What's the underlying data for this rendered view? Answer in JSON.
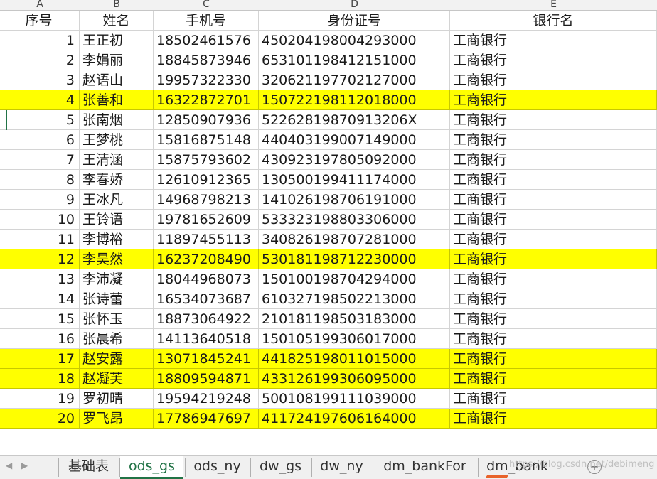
{
  "columns": [
    "A",
    "B",
    "C",
    "D",
    "E"
  ],
  "headers": [
    "序号",
    "姓名",
    "手机号",
    "身份证号",
    "银行名"
  ],
  "rows": [
    [
      "1",
      "王正初",
      "18502461576",
      "450204198004293000",
      "工商银行"
    ],
    [
      "2",
      "李娟丽",
      "18845873946",
      "653101198412151000",
      "工商银行"
    ],
    [
      "3",
      "赵语山",
      "19957322330",
      "320621197702127000",
      "工商银行"
    ],
    [
      "4",
      "张善和",
      "16322872701",
      "150722198112018000",
      "工商银行"
    ],
    [
      "5",
      "张南烟",
      "12850907936",
      "52262819870913206X",
      "工商银行"
    ],
    [
      "6",
      "王梦桃",
      "15816875148",
      "440403199007149000",
      "工商银行"
    ],
    [
      "7",
      "王清涵",
      "15875793602",
      "430923197805092000",
      "工商银行"
    ],
    [
      "8",
      "李春娇",
      "12610912365",
      "130500199411174000",
      "工商银行"
    ],
    [
      "9",
      "王冰凡",
      "14968798213",
      "141026198706191000",
      "工商银行"
    ],
    [
      "10",
      "王铃语",
      "19781652609",
      "533323198803306000",
      "工商银行"
    ],
    [
      "11",
      "李博裕",
      "11897455113",
      "340826198707281000",
      "工商银行"
    ],
    [
      "12",
      "李昊然",
      "16237208490",
      "530181198712230000",
      "工商银行"
    ],
    [
      "13",
      "李沛凝",
      "18044968073",
      "150100198704294000",
      "工商银行"
    ],
    [
      "14",
      "张诗蕾",
      "16534073687",
      "610327198502213000",
      "工商银行"
    ],
    [
      "15",
      "张怀玉",
      "18873064922",
      "210181198503183000",
      "工商银行"
    ],
    [
      "16",
      "张晨希",
      "14113640518",
      "150105199306017000",
      "工商银行"
    ],
    [
      "17",
      "赵安露",
      "13071845241",
      "441825198011015000",
      "工商银行"
    ],
    [
      "18",
      "赵凝芙",
      "18809594871",
      "433126199306095000",
      "工商银行"
    ],
    [
      "19",
      "罗初晴",
      "19594219248",
      "500108199111039000",
      "工商银行"
    ],
    [
      "20",
      "罗飞昂",
      "17786947697",
      "411724197606164000",
      "工商银行"
    ]
  ],
  "highlighted_rows": [
    "4",
    "12",
    "17",
    "18",
    "20"
  ],
  "highlight_color": "#ffff00",
  "sheet_tabs": [
    "基础表",
    "ods_gs",
    "ods_ny",
    "dw_gs",
    "dw_ny",
    "dm_bankFor",
    "dm_bank"
  ],
  "active_tab": "ods_gs",
  "accent_color": "#217346",
  "watermark": "https://blog.csdn.net/debimeng"
}
